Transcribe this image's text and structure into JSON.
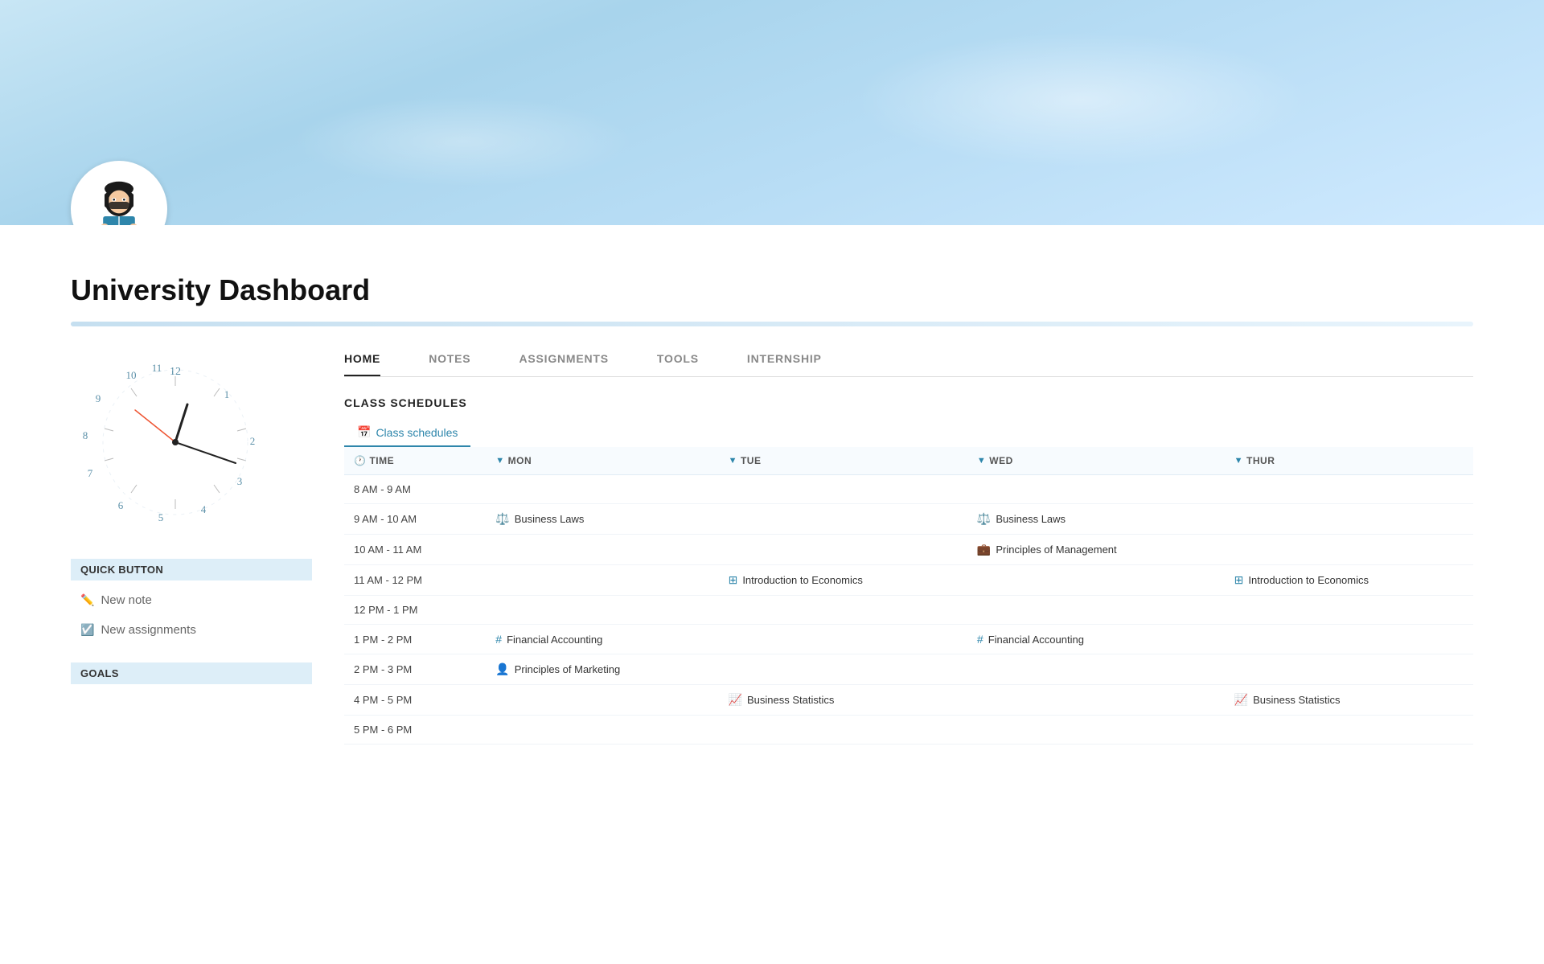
{
  "hero": {
    "title": "University Dashboard"
  },
  "avatar": {
    "alt": "Student reading avatar"
  },
  "nav": {
    "tabs": [
      {
        "id": "home",
        "label": "HOME",
        "active": true
      },
      {
        "id": "notes",
        "label": "NOTES",
        "active": false
      },
      {
        "id": "assignments",
        "label": "ASSIGNMENTS",
        "active": false
      },
      {
        "id": "tools",
        "label": "TOOLS",
        "active": false
      },
      {
        "id": "internship",
        "label": "INTERNSHIP",
        "active": false
      }
    ]
  },
  "class_schedules": {
    "section_title": "CLASS SCHEDULES",
    "tab_label": "Class schedules",
    "columns": [
      "TIME",
      "MON",
      "TUE",
      "WED",
      "THUR"
    ],
    "rows": [
      {
        "time": "8 AM - 9 AM",
        "mon": null,
        "tue": null,
        "wed": null,
        "thur": null
      },
      {
        "time": "9 AM - 10 AM",
        "mon": {
          "name": "Business Laws",
          "icon": "⚖️",
          "type": "law"
        },
        "tue": null,
        "wed": {
          "name": "Business Laws",
          "icon": "⚖️",
          "type": "law"
        },
        "thur": null
      },
      {
        "time": "10 AM - 11 AM",
        "mon": null,
        "tue": null,
        "wed": {
          "name": "Principles of Management",
          "icon": "💼",
          "type": "mgmt"
        },
        "thur": null
      },
      {
        "time": "11 AM - 12 PM",
        "mon": null,
        "tue": {
          "name": "Introduction to Economics",
          "icon": "⊞",
          "type": "econ"
        },
        "wed": null,
        "thur": {
          "name": "Introduction to Economics",
          "icon": "⊞",
          "type": "econ"
        }
      },
      {
        "time": "12 PM - 1 PM",
        "mon": null,
        "tue": null,
        "wed": null,
        "thur": null
      },
      {
        "time": "1 PM - 2 PM",
        "mon": {
          "name": "Financial Accounting",
          "icon": "#",
          "type": "acct"
        },
        "tue": null,
        "wed": {
          "name": "Financial Accounting",
          "icon": "#",
          "type": "acct"
        },
        "thur": null
      },
      {
        "time": "2 PM - 3 PM",
        "mon": {
          "name": "Principles of Marketing",
          "icon": "👤",
          "type": "mktg"
        },
        "tue": null,
        "wed": null,
        "thur": null
      },
      {
        "time": "4 PM - 5 PM",
        "mon": null,
        "tue": {
          "name": "Business Statistics",
          "icon": "📈",
          "type": "stat"
        },
        "wed": null,
        "thur": {
          "name": "Business Statistics",
          "icon": "📈",
          "type": "stat"
        }
      },
      {
        "time": "5 PM - 6 PM",
        "mon": null,
        "tue": null,
        "wed": null,
        "thur": null
      }
    ]
  },
  "quick_button": {
    "title": "QUICK BUTTON",
    "buttons": [
      {
        "id": "new-note",
        "label": "New note",
        "icon": "✏️"
      },
      {
        "id": "new-assignments",
        "label": "New assignments",
        "icon": "☑️"
      }
    ]
  },
  "goals": {
    "title": "GOALS"
  }
}
